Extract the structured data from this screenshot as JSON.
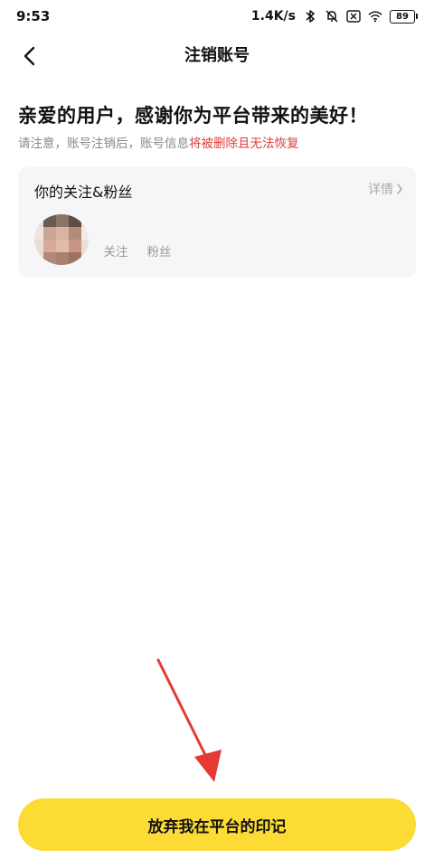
{
  "status_bar": {
    "time": "9:53",
    "network_speed": "1.4K/s",
    "battery": "89",
    "icons": [
      "bluetooth-icon",
      "mute-icon",
      "close-box-icon",
      "wifi-icon",
      "battery-icon"
    ]
  },
  "nav": {
    "title": "注销账号",
    "back_icon": "chevron-left-icon"
  },
  "headline": "亲爱的用户，感谢你为平台带来的美好！",
  "notice": {
    "prefix": "请注意，账号注销后，账号信息",
    "warning": "将被删除且无法恢复"
  },
  "card": {
    "title": "你的关注&粉丝",
    "detail_label": "详情",
    "stats": [
      {
        "label": "关注",
        "value": ""
      },
      {
        "label": "粉丝",
        "value": ""
      }
    ]
  },
  "button": {
    "label": "放弃我在平台的印记"
  },
  "colors": {
    "accent_yellow": "#fcdb34",
    "warning_red": "#e13b3b",
    "card_bg": "#f6f6f8",
    "muted_text": "#888888",
    "annotation_arrow": "#e53935"
  }
}
